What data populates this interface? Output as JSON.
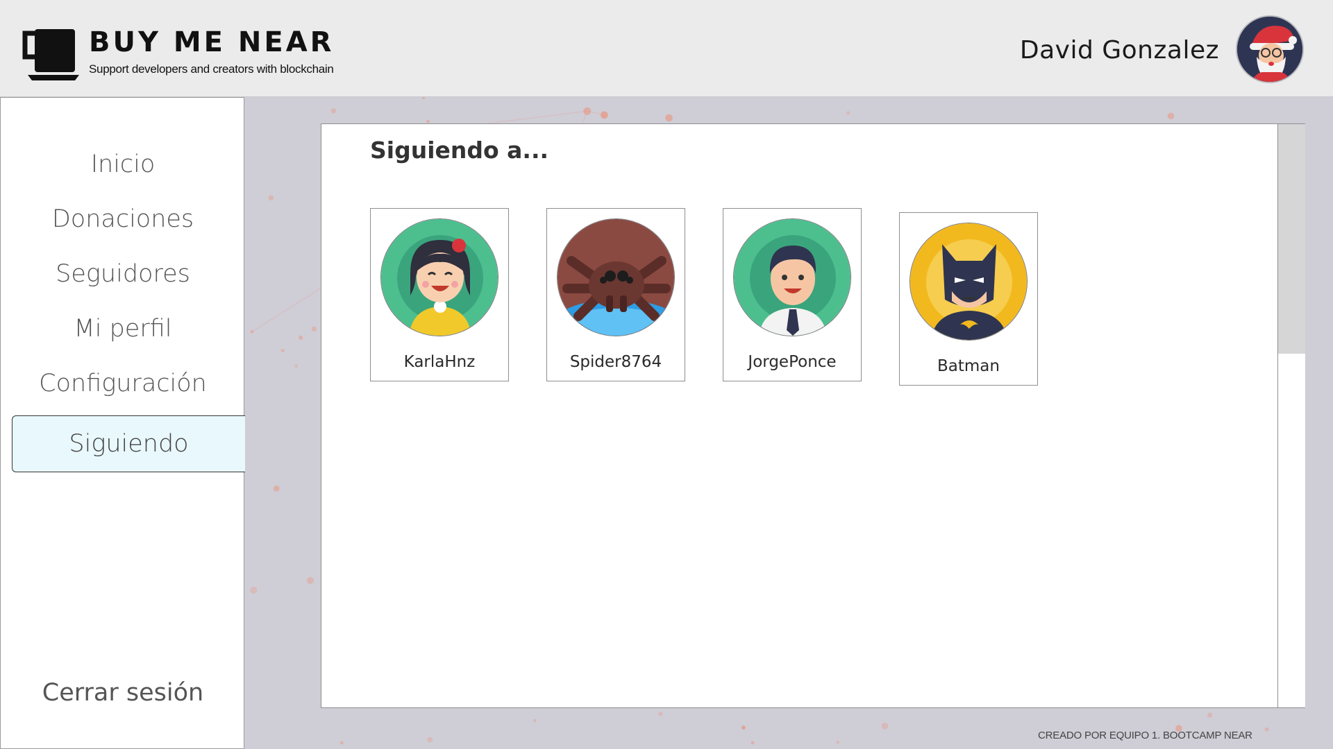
{
  "header": {
    "brand_title": "BUY ME NEAR",
    "brand_tagline": "Support developers and creators with blockchain",
    "username": "David Gonzalez",
    "avatar_icon": "santa-avatar-icon"
  },
  "sidebar": {
    "items": [
      {
        "label": "Inicio",
        "active": false
      },
      {
        "label": "Donaciones",
        "active": false
      },
      {
        "label": "Seguidores",
        "active": false
      },
      {
        "label": "Mi perfil",
        "active": false
      },
      {
        "label": "Configuración",
        "active": false
      },
      {
        "label": "Siguiendo",
        "active": true
      }
    ],
    "logout_label": "Cerrar sesión"
  },
  "main": {
    "title": "Siguiendo a...",
    "following": [
      {
        "name": "KarlaHnz",
        "icon": "girl-avatar-icon"
      },
      {
        "name": "Spider8764",
        "icon": "spider-avatar-icon"
      },
      {
        "name": "JorgePonce",
        "icon": "man-avatar-icon"
      },
      {
        "name": "Batman",
        "icon": "batman-avatar-icon"
      }
    ]
  },
  "footer": {
    "credit": "CREADO POR EQUIPO 1. BOOTCAMP NEAR"
  },
  "colors": {
    "header_bg": "#ebebec",
    "page_bg": "#cfcdd6",
    "active_nav_bg": "#e9f8fc",
    "accent_dots": "#e79a86"
  }
}
